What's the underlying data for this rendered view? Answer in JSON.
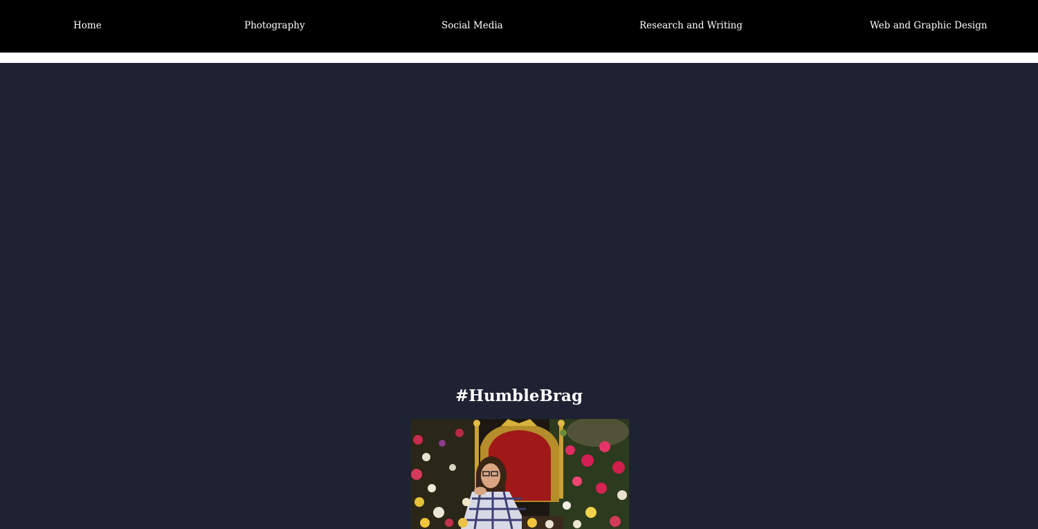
{
  "nav": {
    "items": [
      {
        "label": "Home"
      },
      {
        "label": "Photography"
      },
      {
        "label": "Social Media"
      },
      {
        "label": "Research and Writing"
      },
      {
        "label": "Web and Graphic Design"
      }
    ]
  },
  "main": {
    "heading": "#HumbleBrag"
  },
  "colors": {
    "nav_background": "#000000",
    "page_background": "#1f2233",
    "band": "#ffffff",
    "text": "#ffffff"
  }
}
